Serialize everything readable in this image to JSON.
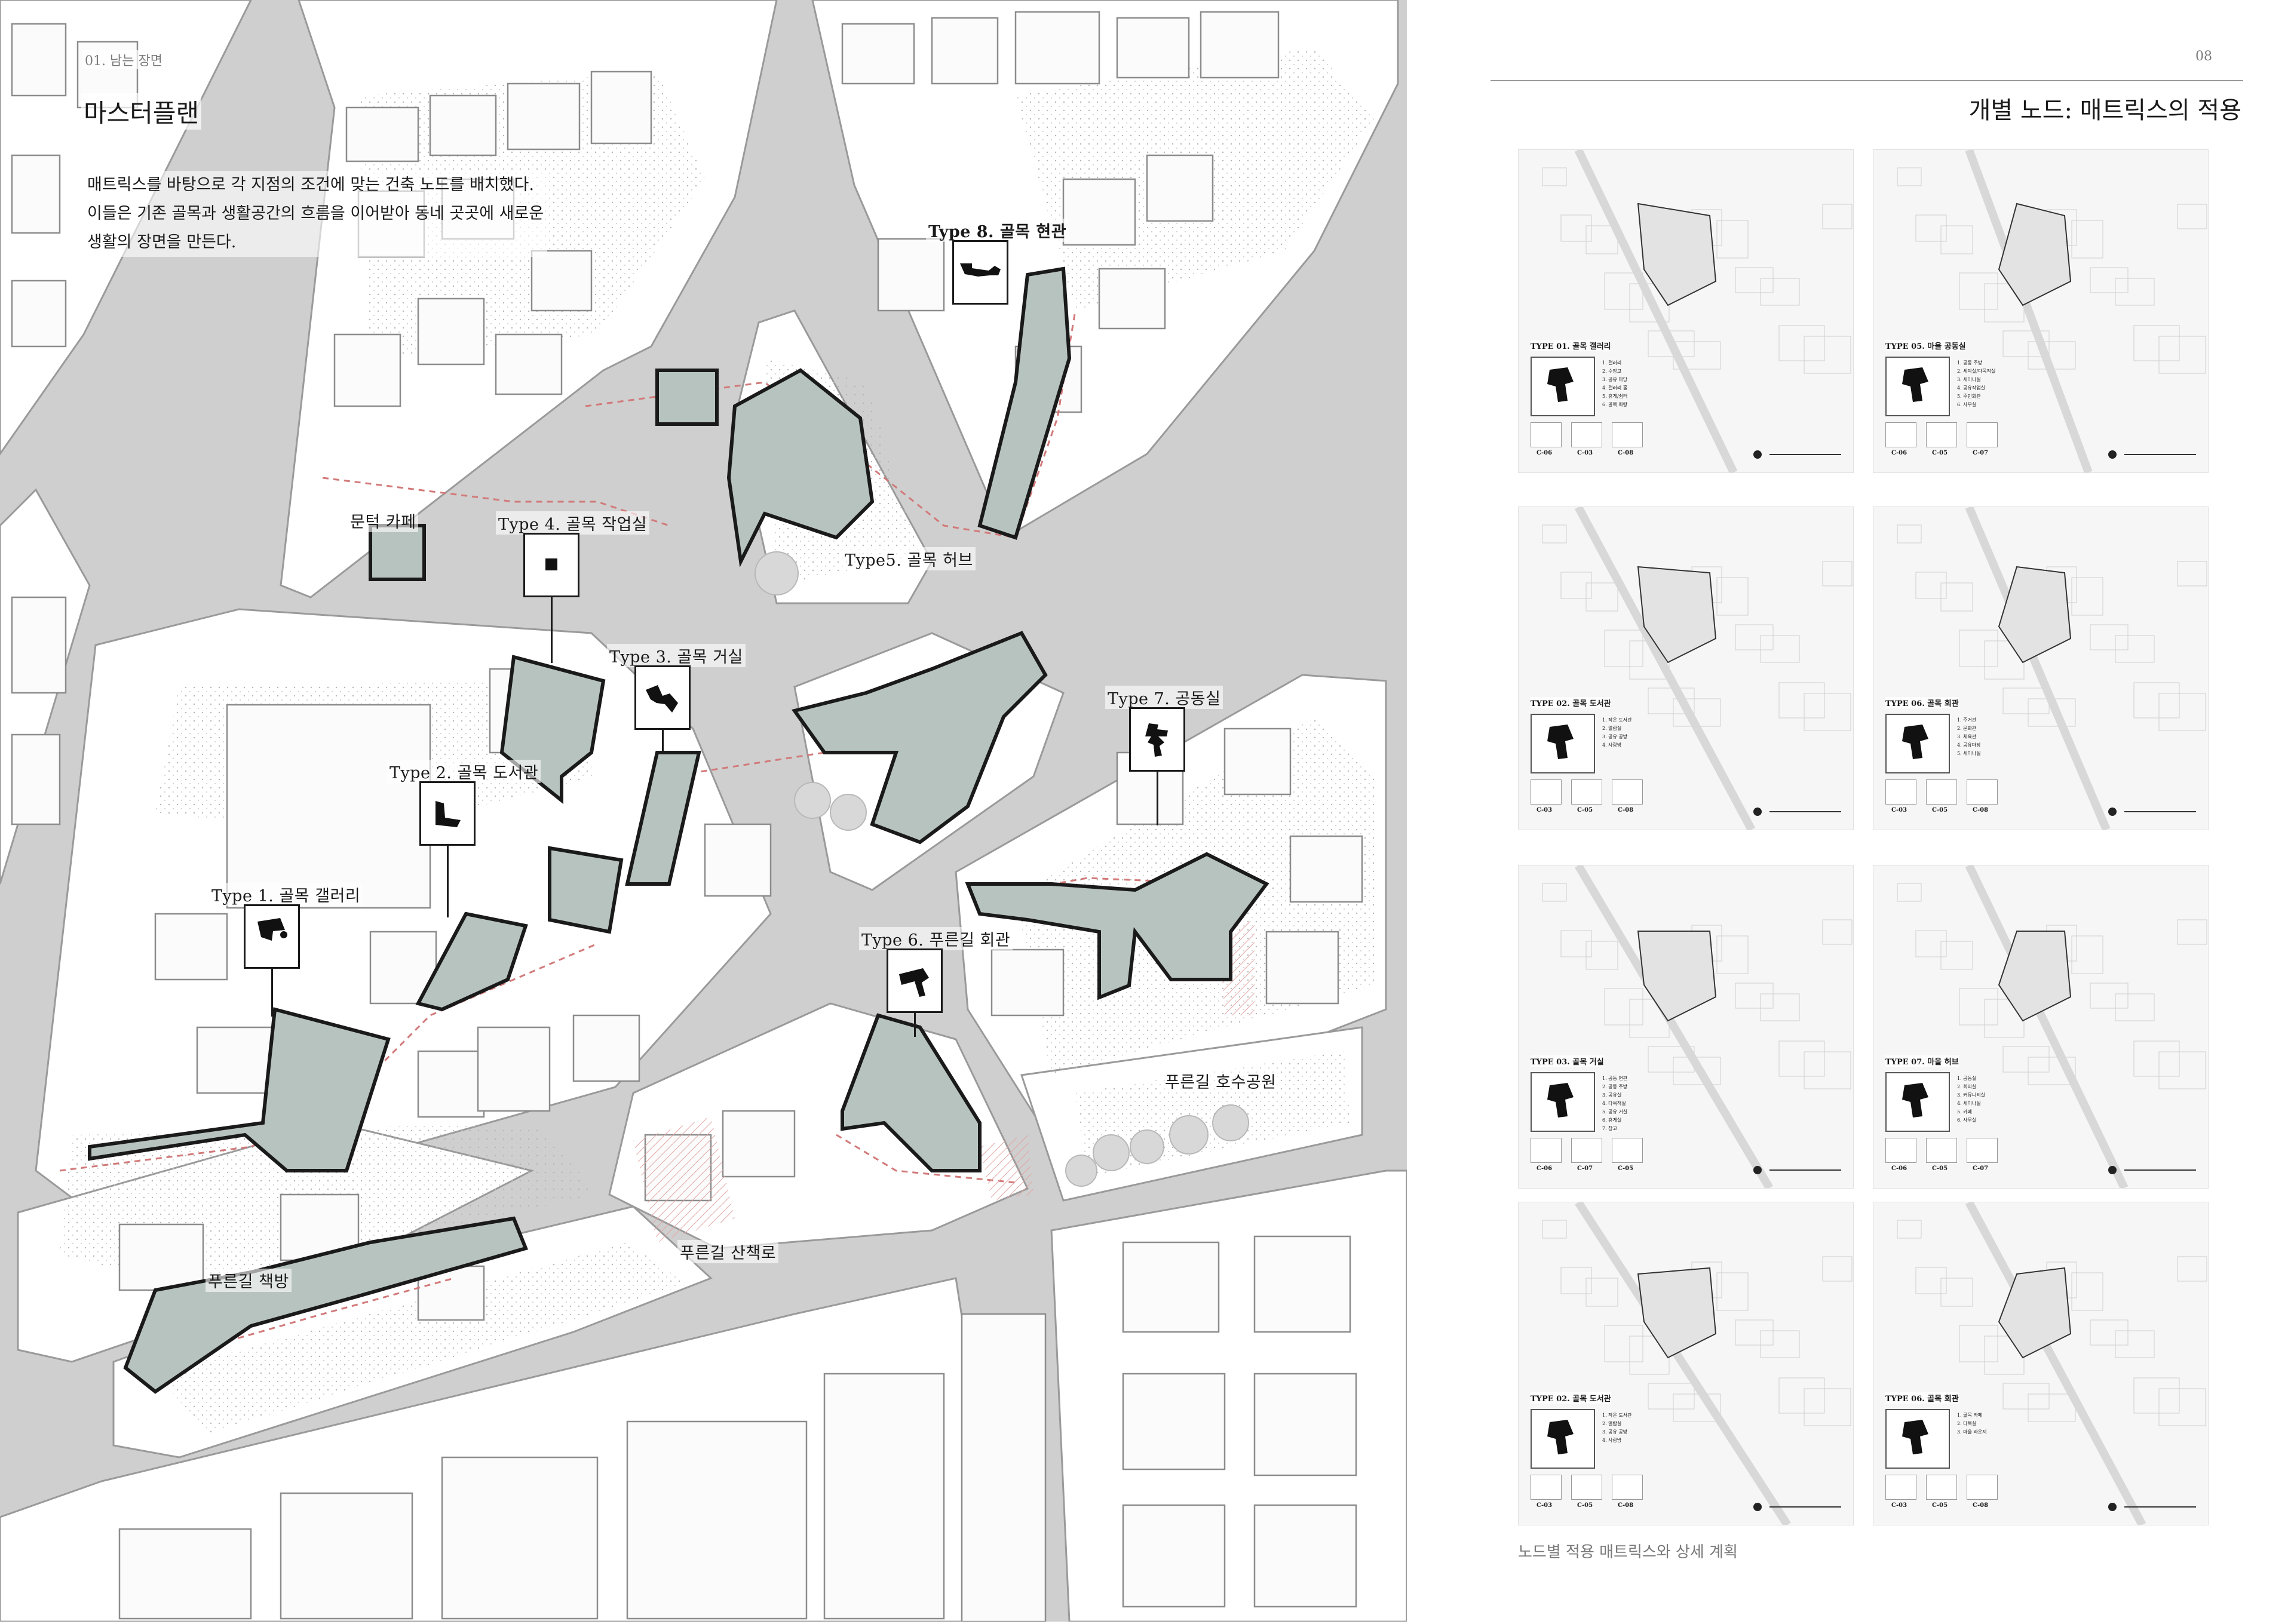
{
  "left_page": {
    "section": "01. 남는 장면",
    "title": "마스터플랜",
    "body": [
      "매트릭스를 바탕으로 각 지점의 조건에 맞는 건축 노드를 배치했다.",
      "이들은 기존 골목과 생활공간의 흐름을 이어받아 동네 곳곳에 새로운",
      "생활의 장면을 만든다."
    ]
  },
  "map_labels": {
    "type1": "Type 1. 골목 갤러리",
    "type2": "Type 2. 골목 도서관",
    "type3": "Type 3. 골목 거실",
    "type4": "Type 4. 골목 작업실",
    "type5": "Type5. 골목 허브",
    "type6": "Type 6. 푸른길 회관",
    "type7": "Type 7. 공동실",
    "type8": "Type 8. 골목 현관",
    "cafe": "문턱 카페",
    "park": "푸른길 호수공원",
    "trail": "푸른길 산책로",
    "bookroom": "푸른길 책방"
  },
  "right_page": {
    "page_number": "08",
    "title": "개별 노드: 매트릭스의 적용",
    "caption": "노드별 적용 매트릭스와 상세 계획",
    "panels": [
      {
        "title": "TYPE 01. 골목 갤러리",
        "items": [
          "1. 갤러리",
          "2. 수장고",
          "3. 공유 마당",
          "4. 갤러리 홀",
          "5. 휴게/쉼터",
          "6. 골목 화랑"
        ],
        "matrix": [
          "C-06",
          "C-03",
          "C-08"
        ]
      },
      {
        "title": "TYPE 05. 마을 공동실",
        "items": [
          "1. 공동 주방",
          "2. 세탁실/다목적실",
          "3. 세미나실",
          "4. 공유작업실",
          "5. 주민회관",
          "6. 사무실"
        ],
        "matrix": [
          "C-06",
          "C-05",
          "C-07"
        ]
      },
      {
        "title": "TYPE 02. 골목 도서관",
        "items": [
          "1. 작은 도서관",
          "2. 열람실",
          "3. 공유 공방",
          "4. 사랑방"
        ],
        "matrix": [
          "C-03",
          "C-05",
          "C-08"
        ]
      },
      {
        "title": "TYPE 06. 골목 회관",
        "items": [
          "1. 주거관",
          "2. 문화관",
          "3. 체육관",
          "4. 공유마당",
          "5. 세미나실"
        ],
        "matrix": [
          "C-03",
          "C-05",
          "C-08"
        ]
      },
      {
        "title": "TYPE 03. 골목 거실",
        "items": [
          "1. 공동 현관",
          "2. 공동 주방",
          "3. 공유실",
          "4. 다목적실",
          "5. 공유 거실",
          "6. 휴게실",
          "7. 창고"
        ],
        "matrix": [
          "C-06",
          "C-07",
          "C-05"
        ]
      },
      {
        "title": "TYPE 07. 마을 허브",
        "items": [
          "1. 공동실",
          "2. 회의실",
          "3. 커뮤니티실",
          "4. 세미나실",
          "5. 카페",
          "6. 사무실"
        ],
        "matrix": [
          "C-06",
          "C-05",
          "C-07"
        ]
      },
      {
        "title": "TYPE 02. 골목 도서관",
        "items": [
          "1. 작은 도서관",
          "2. 열람실",
          "3. 공유 공방",
          "4. 사랑방"
        ],
        "matrix": [
          "C-03",
          "C-05",
          "C-08"
        ]
      },
      {
        "title": "TYPE 06. 골목 회관",
        "items": [
          "1. 골목 카페",
          "2. 다목실",
          "3. 마을 라운지"
        ],
        "matrix": [
          "C-03",
          "C-05",
          "C-08"
        ]
      }
    ]
  },
  "colors": {
    "road": "#cfcfcf",
    "node_fill": "#b7c3bf",
    "path_red": "#d27a7a",
    "ink": "#1a1a1a"
  }
}
